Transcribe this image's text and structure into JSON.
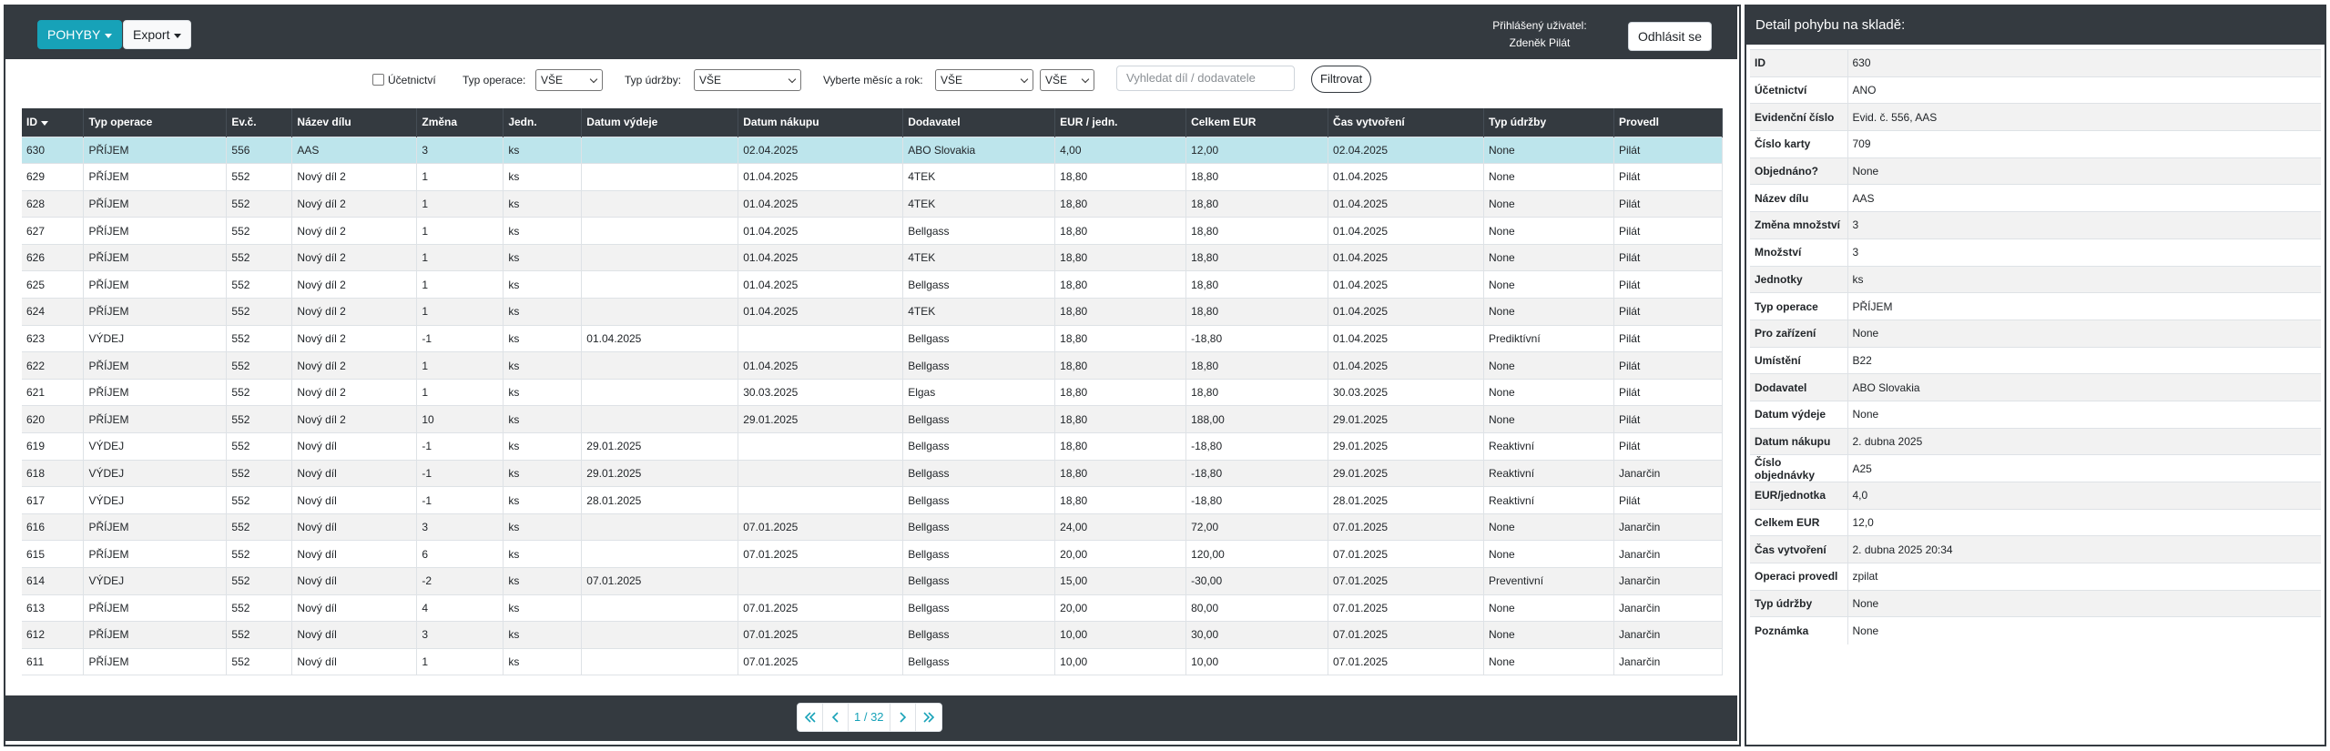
{
  "toolbar": {
    "pohyby_label": "POHYBY",
    "export_label": "Export",
    "user_label": "Přihlášený uživatel:",
    "user_name": "Zdeněk Pilát",
    "logout_label": "Odhlásit se"
  },
  "filters": {
    "ucetnictvi_label": "Účetnictví",
    "ucetnictvi_checked": false,
    "typ_operace_label": "Typ operace:",
    "typ_operace_value": "VŠE",
    "typ_udrzby_label": "Typ údržby:",
    "typ_udrzby_value": "VŠE",
    "mesic_rok_label": "Vyberte měsíc a rok:",
    "mesic_value": "VŠE",
    "rok_value": "VŠE",
    "search_placeholder": "Vyhledat díl / dodavatele",
    "filter_button": "Filtrovat"
  },
  "table": {
    "columns": [
      "ID",
      "Typ operace",
      "Ev.č.",
      "Název dílu",
      "Změna",
      "Jedn.",
      "Datum výdeje",
      "Datum nákupu",
      "Dodavatel",
      "EUR / jedn.",
      "Celkem EUR",
      "Čas vytvoření",
      "Typ údržby",
      "Provedl"
    ],
    "rows": [
      [
        "630",
        "PŘÍJEM",
        "556",
        "AAS",
        "3",
        "ks",
        "",
        "02.04.2025",
        "ABO Slovakia",
        "4,00",
        "12,00",
        "02.04.2025",
        "None",
        "Pilát"
      ],
      [
        "629",
        "PŘÍJEM",
        "552",
        "Nový díl 2",
        "1",
        "ks",
        "",
        "01.04.2025",
        "4TEK",
        "18,80",
        "18,80",
        "01.04.2025",
        "None",
        "Pilát"
      ],
      [
        "628",
        "PŘÍJEM",
        "552",
        "Nový díl 2",
        "1",
        "ks",
        "",
        "01.04.2025",
        "4TEK",
        "18,80",
        "18,80",
        "01.04.2025",
        "None",
        "Pilát"
      ],
      [
        "627",
        "PŘÍJEM",
        "552",
        "Nový díl 2",
        "1",
        "ks",
        "",
        "01.04.2025",
        "Bellgass",
        "18,80",
        "18,80",
        "01.04.2025",
        "None",
        "Pilát"
      ],
      [
        "626",
        "PŘÍJEM",
        "552",
        "Nový díl 2",
        "1",
        "ks",
        "",
        "01.04.2025",
        "4TEK",
        "18,80",
        "18,80",
        "01.04.2025",
        "None",
        "Pilát"
      ],
      [
        "625",
        "PŘÍJEM",
        "552",
        "Nový díl 2",
        "1",
        "ks",
        "",
        "01.04.2025",
        "Bellgass",
        "18,80",
        "18,80",
        "01.04.2025",
        "None",
        "Pilát"
      ],
      [
        "624",
        "PŘÍJEM",
        "552",
        "Nový díl 2",
        "1",
        "ks",
        "",
        "01.04.2025",
        "4TEK",
        "18,80",
        "18,80",
        "01.04.2025",
        "None",
        "Pilát"
      ],
      [
        "623",
        "VÝDEJ",
        "552",
        "Nový díl 2",
        "-1",
        "ks",
        "01.04.2025",
        "",
        "Bellgass",
        "18,80",
        "-18,80",
        "01.04.2025",
        "Prediktívní",
        "Pilát"
      ],
      [
        "622",
        "PŘÍJEM",
        "552",
        "Nový díl 2",
        "1",
        "ks",
        "",
        "01.04.2025",
        "Bellgass",
        "18,80",
        "18,80",
        "01.04.2025",
        "None",
        "Pilát"
      ],
      [
        "621",
        "PŘÍJEM",
        "552",
        "Nový díl 2",
        "1",
        "ks",
        "",
        "30.03.2025",
        "Elgas",
        "18,80",
        "18,80",
        "30.03.2025",
        "None",
        "Pilát"
      ],
      [
        "620",
        "PŘÍJEM",
        "552",
        "Nový díl 2",
        "10",
        "ks",
        "",
        "29.01.2025",
        "Bellgass",
        "18,80",
        "188,00",
        "29.01.2025",
        "None",
        "Pilát"
      ],
      [
        "619",
        "VÝDEJ",
        "552",
        "Nový díl",
        "-1",
        "ks",
        "29.01.2025",
        "",
        "Bellgass",
        "18,80",
        "-18,80",
        "29.01.2025",
        "Reaktivní",
        "Pilát"
      ],
      [
        "618",
        "VÝDEJ",
        "552",
        "Nový díl",
        "-1",
        "ks",
        "29.01.2025",
        "",
        "Bellgass",
        "18,80",
        "-18,80",
        "29.01.2025",
        "Reaktivní",
        "Janarčin"
      ],
      [
        "617",
        "VÝDEJ",
        "552",
        "Nový díl",
        "-1",
        "ks",
        "28.01.2025",
        "",
        "Bellgass",
        "18,80",
        "-18,80",
        "28.01.2025",
        "Reaktivní",
        "Pilát"
      ],
      [
        "616",
        "PŘÍJEM",
        "552",
        "Nový díl",
        "3",
        "ks",
        "",
        "07.01.2025",
        "Bellgass",
        "24,00",
        "72,00",
        "07.01.2025",
        "None",
        "Janarčin"
      ],
      [
        "615",
        "PŘÍJEM",
        "552",
        "Nový díl",
        "6",
        "ks",
        "",
        "07.01.2025",
        "Bellgass",
        "20,00",
        "120,00",
        "07.01.2025",
        "None",
        "Janarčin"
      ],
      [
        "614",
        "VÝDEJ",
        "552",
        "Nový díl",
        "-2",
        "ks",
        "07.01.2025",
        "",
        "Bellgass",
        "15,00",
        "-30,00",
        "07.01.2025",
        "Preventivní",
        "Janarčin"
      ],
      [
        "613",
        "PŘÍJEM",
        "552",
        "Nový díl",
        "4",
        "ks",
        "",
        "07.01.2025",
        "Bellgass",
        "20,00",
        "80,00",
        "07.01.2025",
        "None",
        "Janarčin"
      ],
      [
        "612",
        "PŘÍJEM",
        "552",
        "Nový díl",
        "3",
        "ks",
        "",
        "07.01.2025",
        "Bellgass",
        "10,00",
        "30,00",
        "07.01.2025",
        "None",
        "Janarčin"
      ],
      [
        "611",
        "PŘÍJEM",
        "552",
        "Nový díl",
        "1",
        "ks",
        "",
        "07.01.2025",
        "Bellgass",
        "10,00",
        "10,00",
        "07.01.2025",
        "None",
        "Janarčin"
      ]
    ]
  },
  "pagination": {
    "label": "1 / 32"
  },
  "detail": {
    "title": "Detail pohybu na skladě:",
    "rows": [
      [
        "ID",
        "630"
      ],
      [
        "Účetnictví",
        "ANO"
      ],
      [
        "Evidenční číslo",
        "Evid. č. 556, AAS"
      ],
      [
        "Číslo karty",
        "709"
      ],
      [
        "Objednáno?",
        "None"
      ],
      [
        "Název dílu",
        "AAS"
      ],
      [
        "Změna množství",
        "3"
      ],
      [
        "Množství",
        "3"
      ],
      [
        "Jednotky",
        "ks"
      ],
      [
        "Typ operace",
        "PŘÍJEM"
      ],
      [
        "Pro zařízení",
        "None"
      ],
      [
        "Umístění",
        "B22"
      ],
      [
        "Dodavatel",
        "ABO Slovakia"
      ],
      [
        "Datum výdeje",
        "None"
      ],
      [
        "Datum nákupu",
        "2. dubna 2025"
      ],
      [
        "Číslo objednávky",
        "A25"
      ],
      [
        "EUR/jednotka",
        "4,0"
      ],
      [
        "Celkem EUR",
        "12,0"
      ],
      [
        "Čas vytvoření",
        "2. dubna 2025 20:34"
      ],
      [
        "Operaci provedl",
        "zpilat"
      ],
      [
        "Typ údržby",
        "None"
      ],
      [
        "Poznámka",
        "None"
      ]
    ]
  },
  "colors": {
    "dark": "#343a40",
    "accent": "#17a2b8",
    "selected_row": "#bde5ec",
    "stripe": "#f2f2f2"
  },
  "icons": {
    "sort": "caret-down-icon",
    "first": "double-chevron-left-icon",
    "prev": "chevron-left-icon",
    "next": "chevron-right-icon",
    "last": "double-chevron-right-icon"
  }
}
